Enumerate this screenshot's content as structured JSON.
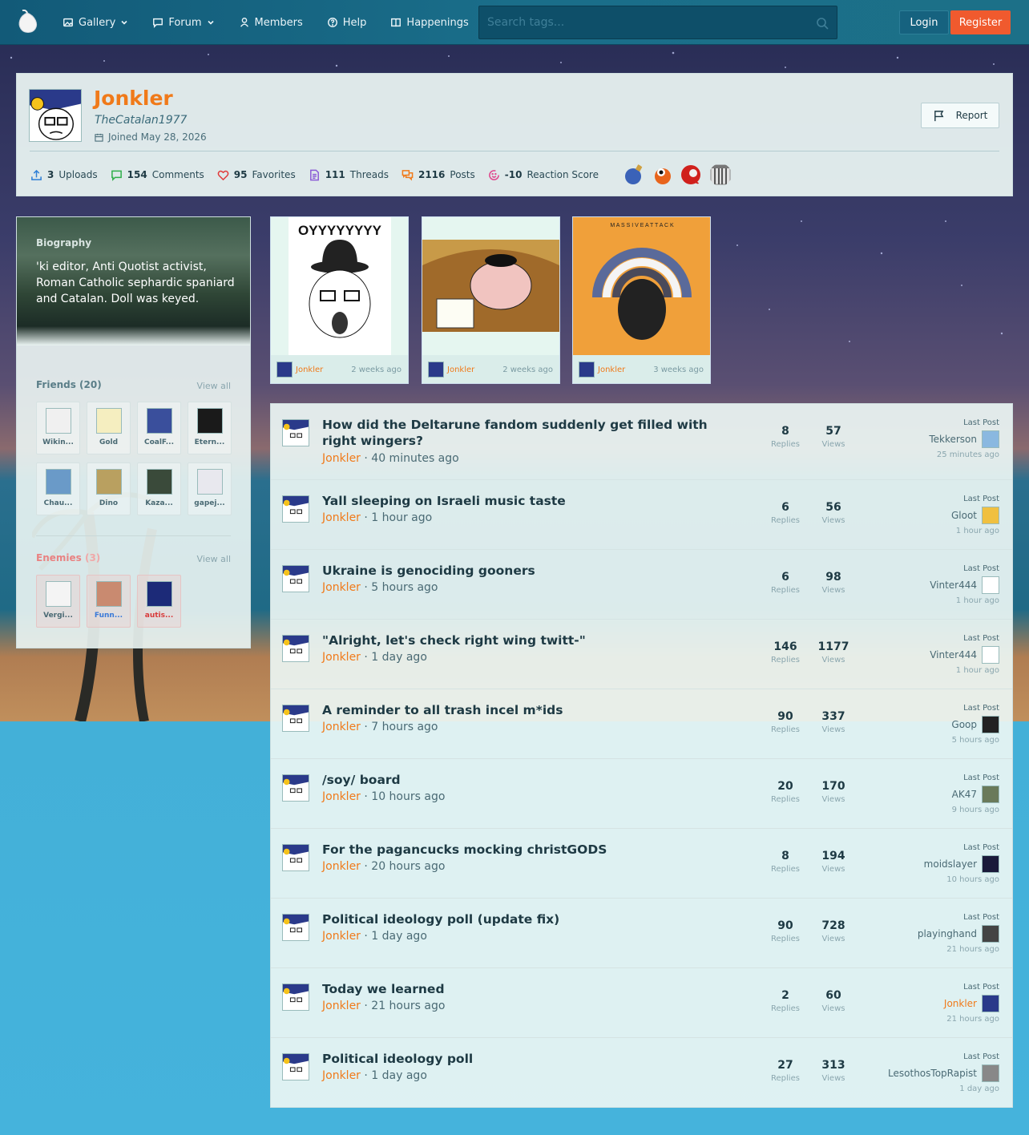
{
  "nav": {
    "items": [
      {
        "label": "Gallery",
        "icon": "image-icon",
        "has_dropdown": true
      },
      {
        "label": "Forum",
        "icon": "chat-icon",
        "has_dropdown": true
      },
      {
        "label": "Members",
        "icon": "user-icon",
        "has_dropdown": false
      },
      {
        "label": "Help",
        "icon": "help-icon",
        "has_dropdown": false
      },
      {
        "label": "Happenings",
        "icon": "book-icon",
        "has_dropdown": false
      }
    ],
    "search_placeholder": "Search tags...",
    "login": "Login",
    "register": "Register"
  },
  "profile": {
    "username": "Jonkler",
    "title": "TheCatalan1977",
    "joined": "Joined May 28, 2026",
    "report": "Report",
    "stats": [
      {
        "icon": "upload-icon",
        "value": "3",
        "label": "Uploads",
        "color": "#2d7fd6"
      },
      {
        "icon": "comment-icon",
        "value": "154",
        "label": "Comments",
        "color": "#2fae4a"
      },
      {
        "icon": "heart-icon",
        "value": "95",
        "label": "Favorites",
        "color": "#e03a3a"
      },
      {
        "icon": "document-icon",
        "value": "111",
        "label": "Threads",
        "color": "#8a5ad6"
      },
      {
        "icon": "posts-icon",
        "value": "2116",
        "label": "Posts",
        "color": "#f07a1a"
      },
      {
        "icon": "reaction-icon",
        "value": "-10",
        "label": "Reaction Score",
        "color": "#e0428a"
      }
    ]
  },
  "biography": {
    "heading": "Biography",
    "text": "'ki editor, Anti Quotist activist, Roman Catholic sephardic spaniard and Catalan. Doll was keyed."
  },
  "friends": {
    "heading": "Friends (20)",
    "view_all": "View all",
    "items": [
      "Wikin...",
      "Gold",
      "CoalF...",
      "Etern...",
      "Chau...",
      "Dino",
      "Kaza...",
      "gapej..."
    ]
  },
  "enemies": {
    "heading": "Enemies",
    "count": "(3)",
    "view_all": "View all",
    "items": [
      "Vergi...",
      "Funn...",
      "autis..."
    ]
  },
  "uploads": [
    {
      "user": "Jonkler",
      "time": "2 weeks ago",
      "caption": "OYYYYYYYY"
    },
    {
      "user": "Jonkler",
      "time": "2 weeks ago",
      "caption": ""
    },
    {
      "user": "Jonkler",
      "time": "3 weeks ago",
      "caption": "M A S S I V E   A T T A C K"
    }
  ],
  "threads": [
    {
      "title": "How did the Deltarune fandom suddenly get filled with right wingers?",
      "author": "Jonkler",
      "time": "40 minutes ago",
      "replies": "8",
      "views": "57",
      "last_user": "Tekkerson",
      "last_time": "25 minutes ago"
    },
    {
      "title": "Yall sleeping on Israeli music taste",
      "author": "Jonkler",
      "time": "1 hour ago",
      "replies": "6",
      "views": "56",
      "last_user": "Gloot",
      "last_time": "1 hour ago"
    },
    {
      "title": "Ukraine is genociding gooners",
      "author": "Jonkler",
      "time": "5 hours ago",
      "replies": "6",
      "views": "98",
      "last_user": "Vinter444",
      "last_time": "1 hour ago"
    },
    {
      "title": "\"Alright, let's check right wing twitt-\"",
      "author": "Jonkler",
      "time": "1 day ago",
      "replies": "146",
      "views": "1177",
      "last_user": "Vinter444",
      "last_time": "1 hour ago"
    },
    {
      "title": "A reminder to all trash incel m*ids",
      "author": "Jonkler",
      "time": "7 hours ago",
      "replies": "90",
      "views": "337",
      "last_user": "Goop",
      "last_time": "5 hours ago"
    },
    {
      "title": "/soy/ board",
      "author": "Jonkler",
      "time": "10 hours ago",
      "replies": "20",
      "views": "170",
      "last_user": "AK47",
      "last_time": "9 hours ago"
    },
    {
      "title": "For the pagancucks mocking christGODS",
      "author": "Jonkler",
      "time": "20 hours ago",
      "replies": "8",
      "views": "194",
      "last_user": "moidslayer",
      "last_time": "10 hours ago"
    },
    {
      "title": "Political ideology poll (update fix)",
      "author": "Jonkler",
      "time": "1 day ago",
      "replies": "90",
      "views": "728",
      "last_user": "playinghand",
      "last_time": "21 hours ago"
    },
    {
      "title": "Today we learned",
      "author": "Jonkler",
      "time": "21 hours ago",
      "replies": "2",
      "views": "60",
      "last_user": "Jonkler",
      "last_time": "21 hours ago"
    },
    {
      "title": "Political ideology poll",
      "author": "Jonkler",
      "time": "1 day ago",
      "replies": "27",
      "views": "313",
      "last_user": "LesothosTopRapist",
      "last_time": "1 day ago"
    }
  ],
  "labels": {
    "replies": "Replies",
    "views": "Views",
    "last_post": "Last Post",
    "separator": "·"
  }
}
